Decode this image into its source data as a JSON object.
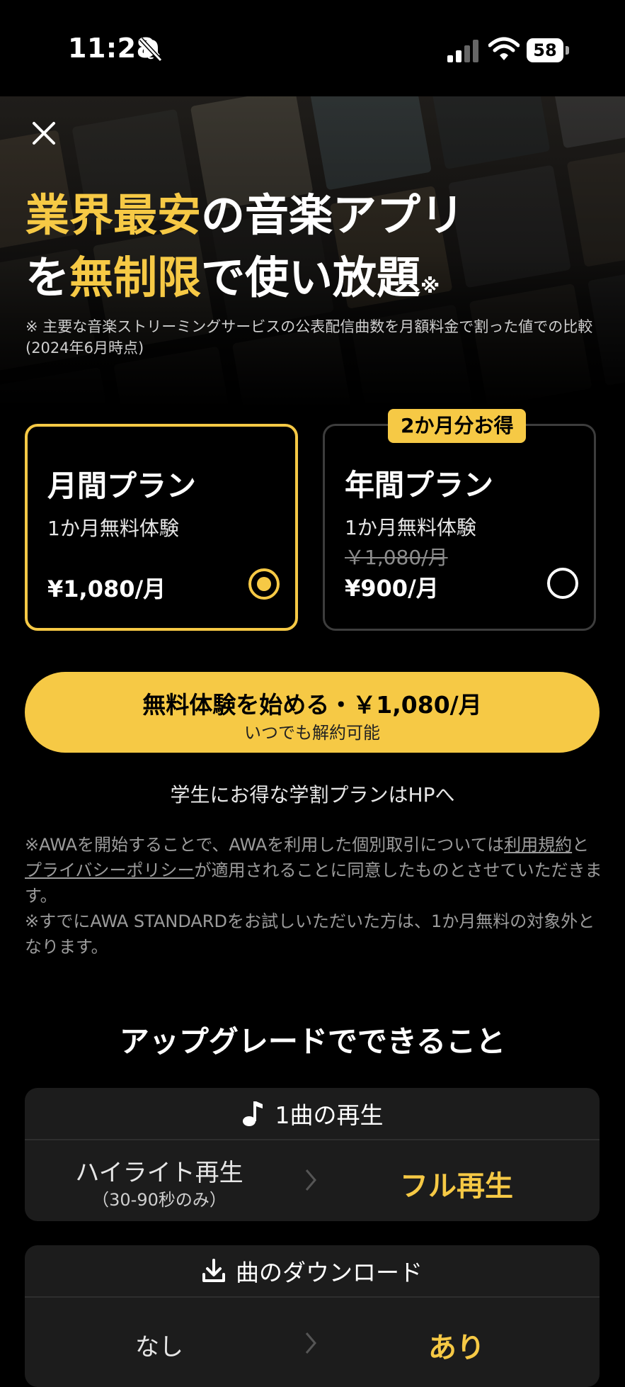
{
  "status": {
    "time": "11:28",
    "battery": "58"
  },
  "hero": {
    "headline_line1_accent": "業界最安",
    "headline_line1_rest": "の音楽アプリ",
    "headline_line2_a": "を",
    "headline_line2_accent": "無制限",
    "headline_line2_rest": "で使い放題",
    "headline_mark": "※",
    "disclaimer": "※ 主要な音楽ストリーミングサービスの公表配信曲数を月額料金で割った値での比較 (2024年6月時点)"
  },
  "plans": {
    "monthly": {
      "title": "月間プラン",
      "trial": "1か月無料体験",
      "price": "¥1,080/月",
      "selected": true
    },
    "annual": {
      "badge": "2か月分お得",
      "title": "年間プラン",
      "trial": "1か月無料体験",
      "old_price": "￥1,080/月",
      "price": "¥900/月",
      "selected": false
    }
  },
  "cta": {
    "main": "無料体験を始める・￥1,080/月",
    "sub": "いつでも解約可能"
  },
  "student_link": "学生にお得な学割プランはHPへ",
  "terms": {
    "part1": "※AWAを開始することで、AWAを利用した個別取引については",
    "terms_link": "利用規約",
    "part2": "と",
    "privacy_link": "プライバシーポリシー",
    "part3": "が適用されることに同意したものとさせていただきます。",
    "note2": "※すでにAWA STANDARDをお試しいただいた方は、1か月無料の対象外となります。"
  },
  "upgrade": {
    "title": "アップグレードでできること",
    "items": [
      {
        "icon": "music-note-icon",
        "head": "1曲の再生",
        "before": "ハイライト再生",
        "before_sub": "（30-90秒のみ）",
        "after": "フル再生"
      },
      {
        "icon": "download-icon",
        "head": "曲のダウンロード",
        "before": "なし",
        "after": "あり"
      }
    ]
  },
  "colors": {
    "accent": "#f6c945",
    "background": "#000000",
    "card": "#1c1c1c"
  }
}
